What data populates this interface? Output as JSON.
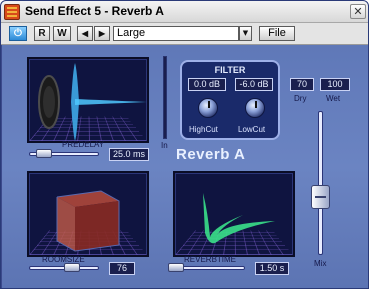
{
  "window": {
    "title": "Send Effect 5 - Reverb A",
    "close_glyph": "✕"
  },
  "toolbar": {
    "power_glyph": "⏻",
    "read_label": "R",
    "write_label": "W",
    "prev_glyph": "◀",
    "next_glyph": "▶",
    "preset": "Large",
    "dropdown_glyph": "▼",
    "file_label": "File"
  },
  "plugin": {
    "name": "Reverb A",
    "in_label": "In",
    "predelay": {
      "label": "PREDELAY",
      "value": "25.0 ms"
    },
    "filter": {
      "title": "FILTER",
      "high_cut": {
        "label": "HighCut",
        "value": "0.0 dB"
      },
      "low_cut": {
        "label": "LowCut",
        "value": "-6.0 dB"
      }
    },
    "dry": {
      "label": "Dry",
      "value": "70"
    },
    "wet": {
      "label": "Wet",
      "value": "100"
    },
    "roomsize": {
      "label": "ROOMSIZE",
      "value": "76"
    },
    "reverbtime": {
      "label": "REVERBTIME",
      "value": "1.50 s"
    },
    "mix": {
      "label": "Mix"
    }
  },
  "colors": {
    "accent": "#5f78b8",
    "display_bg": "#0f1440",
    "green_trace": "#3ae08a"
  }
}
